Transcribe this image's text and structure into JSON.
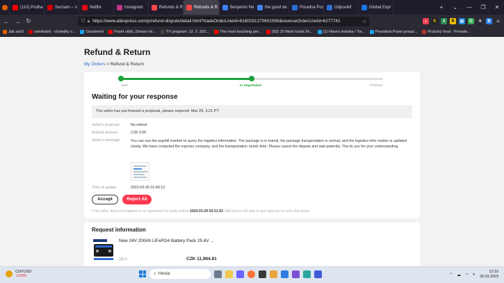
{
  "browser": {
    "tabs": [
      {
        "label": "(110) Podha",
        "color": "#ff0000"
      },
      {
        "label": "Seznam – n",
        "color": "#cc0000"
      },
      {
        "label": "Netflix",
        "color": "#e50914"
      },
      {
        "label": "Instagram",
        "color": "#c13584"
      },
      {
        "label": "Refunds & R",
        "color": "#ff4747"
      },
      {
        "label": "Refunds & R",
        "color": "#ff4747",
        "active": true
      },
      {
        "label": "Benjamin Ne",
        "color": "#3b82f6"
      },
      {
        "label": "the good de",
        "color": "#4285f4"
      },
      {
        "label": "Poradna Pos",
        "color": "#2a6fd6"
      },
      {
        "label": "Odpověď",
        "color": "#2a6fd6"
      },
      {
        "label": "Global Expr",
        "color": "#1a73e8"
      }
    ],
    "url": "https://www.aliexpress.com/p/refund-dispute/detail.html?tradeOrderLineId=8160251270601956&reverseOrderLineId=6277741",
    "bookmarks": [
      {
        "label": "Jak začít",
        "color": "#e66000"
      },
      {
        "label": "náměstek - výsledky v...",
        "color": "#cc0000"
      },
      {
        "label": "Oznámení",
        "color": "#1da1f2"
      },
      {
        "label": "Pavel ušlzt, Zeman mi...",
        "color": "#ff0000"
      },
      {
        "label": "TV program: 12. 2. 202...",
        "color": "#444444"
      },
      {
        "label": "The most touching per...",
        "color": "#ff0000"
      },
      {
        "label": "(83) 10 Most Iconic M...",
        "color": "#ff0000"
      },
      {
        "label": "(1) Hlavní stránka / Tw...",
        "color": "#1da1f2"
      },
      {
        "label": "Prezident Pavel porazi...",
        "color": "#1da1f2"
      },
      {
        "label": "Pražský hrad - Preside...",
        "color": "#b33"
      }
    ]
  },
  "page": {
    "title": "Refund & Return",
    "breadcrumb": {
      "link": "My Orders",
      "separator": ">",
      "current": "Refund & Return"
    },
    "progress": {
      "steps": [
        "Start",
        "In negotiation",
        "Finished"
      ],
      "current_index": 1,
      "fraction": 0.5
    },
    "waiting_title": "Waiting for your response",
    "notice": "The seller has put forward a proposal, please respond: Mar 29, 3:21 PT",
    "details": {
      "proposal_label": "Seller's proposal:",
      "proposal_value": "No refund",
      "amount_label": "Refund amount :",
      "amount_value": "CZK 0.00",
      "message_label": "Seller's message:",
      "message_value": "You can use the waybill number to query the logistics information. The package is in transit, the package transportation is normal, and the logistics infor mation is updated slowly. We have contacted the express company, and the transportation needs time. Please cancel the dispute and wait patiently. Tha nk you for your understanding.",
      "time_label": "Time of update:",
      "time_value": "2023-03-25 01:49:12"
    },
    "buttons": {
      "accept": "Accept",
      "reject": "Reject All"
    },
    "footnote": {
      "before": "If the seller does not respond or no agreement is made before",
      "date": "2023-03-29 03:21:53",
      "after": ", AliExpress will step in and help you to solve this issue."
    },
    "request": {
      "title": "Request information",
      "product_name": "New 24V 200Ah LiFePO4 Battery Pack 25.6V ...",
      "qty_label": "Qty:2",
      "price": "CZK 11,964.81"
    }
  },
  "taskbar": {
    "ticker": "CNYUSD",
    "change": "-0,68%",
    "search": "Hledat",
    "time": "12:19",
    "date": "25.03.2023"
  }
}
